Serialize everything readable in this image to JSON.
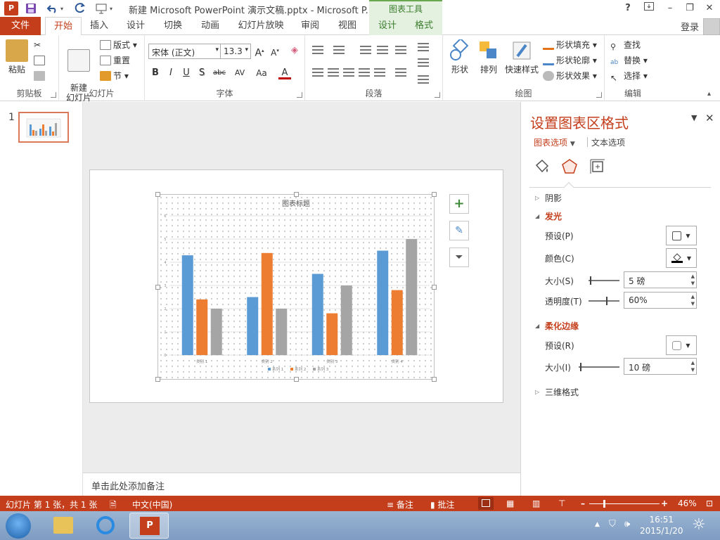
{
  "title_bar": {
    "app_icon": "P",
    "doc_title": "新建 Microsoft PowerPoint 演示文稿.pptx - Microsoft P...",
    "context_tools": "图表工具",
    "help": "?",
    "minimize": "–",
    "restore": "❐",
    "close": "✕",
    "login": "登录"
  },
  "tabs": {
    "file": "文件",
    "home": "开始",
    "insert": "插入",
    "design": "设计",
    "transitions": "切换",
    "animations": "动画",
    "slideshow": "幻灯片放映",
    "review": "审阅",
    "view": "视图",
    "chart_design": "设计",
    "chart_format": "格式"
  },
  "ribbon": {
    "clipboard": {
      "paste": "粘贴",
      "label": "剪贴板"
    },
    "slides": {
      "new_slide": "新建\n幻灯片",
      "layout": "版式",
      "reset": "重置",
      "section": "节",
      "label": "幻灯片"
    },
    "font": {
      "font_name": "宋体 (正文)",
      "font_size": "13.3",
      "bold": "B",
      "italic": "I",
      "underline": "U",
      "shadow": "S",
      "strike": "abc",
      "spacing": "AV",
      "case": "Aa",
      "color": "A",
      "label": "字体"
    },
    "paragraph": {
      "label": "段落"
    },
    "drawing": {
      "shapes": "形状",
      "arrange": "排列",
      "quick_styles": "快速样式",
      "shape_fill": "形状填充",
      "shape_outline": "形状轮廓",
      "shape_effects": "形状效果",
      "label": "绘图"
    },
    "editing": {
      "find": "查找",
      "replace": "替换",
      "select": "选择",
      "label": "编辑"
    }
  },
  "thumbnails": {
    "slide_number": "1"
  },
  "notes": {
    "placeholder": "单击此处添加备注"
  },
  "chart_data": {
    "type": "bar",
    "title": "图表标题",
    "categories": [
      "类别 1",
      "类别 2",
      "类别 3",
      "类别 4"
    ],
    "series": [
      {
        "name": "系列 1",
        "values": [
          4.3,
          2.5,
          3.5,
          4.5
        ],
        "color": "#5b9bd5"
      },
      {
        "name": "系列 2",
        "values": [
          2.4,
          4.4,
          1.8,
          2.8
        ],
        "color": "#ed7d31"
      },
      {
        "name": "系列 3",
        "values": [
          2.0,
          2.0,
          3.0,
          5.0
        ],
        "color": "#a5a5a5"
      }
    ],
    "ylim": [
      0,
      6
    ],
    "yticks": [
      "0",
      "1",
      "2",
      "3",
      "4",
      "5",
      "6"
    ],
    "grid": true,
    "legend": "bottom"
  },
  "chart_buttons": {
    "add": "+",
    "style": "✎",
    "filter": "⏷"
  },
  "format_pane": {
    "title": "设置图表区格式",
    "tab_chart_options": "图表选项",
    "tab_text_options": "文本选项",
    "section_shadow": "阴影",
    "section_glow": "发光",
    "glow_preset": "预设(P)",
    "glow_color": "颜色(C)",
    "glow_size": "大小(S)",
    "glow_size_value": "5 磅",
    "glow_transparency": "透明度(T)",
    "glow_transparency_value": "60%",
    "section_soft_edges": "柔化边缘",
    "soft_preset": "预设(R)",
    "soft_size": "大小(I)",
    "soft_size_value": "10 磅",
    "section_3d": "三维格式"
  },
  "status_bar": {
    "slide_info": "幻灯片 第 1 张，共 1 张",
    "language": "中文(中国)",
    "notes": "备注",
    "comments": "批注",
    "zoom": "46%"
  },
  "taskbar": {
    "time": "16:51",
    "date": "2015/1/20"
  },
  "colors": {
    "accent": "#c43e1c",
    "context": "#6aa84f"
  }
}
